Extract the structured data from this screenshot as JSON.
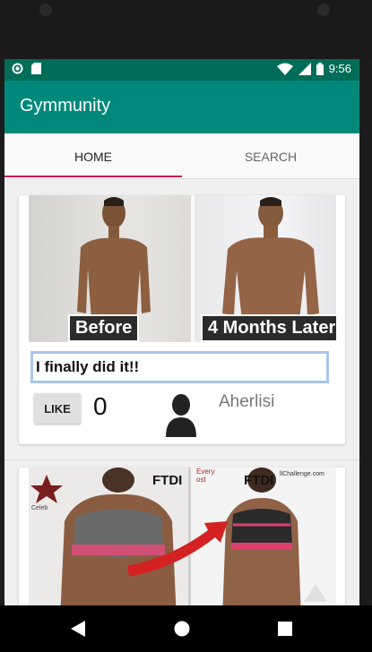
{
  "status_bar": {
    "time": "9:56",
    "icons": [
      "circle-status-icon",
      "sd-card-icon",
      "wifi-icon",
      "signal-icon",
      "battery-icon"
    ]
  },
  "app_bar": {
    "title": "Gymmunity"
  },
  "tabs": [
    {
      "label": "HOME",
      "selected": true
    },
    {
      "label": "SEARCH",
      "selected": false
    }
  ],
  "colors": {
    "status_bar": "#006d58",
    "app_bar": "#00897b",
    "tab_indicator": "#c2185b",
    "caption_border": "#a9c5ee"
  },
  "posts": [
    {
      "photo": {
        "before_label": "Before",
        "after_label": "4 Months Later"
      },
      "caption": "I finally did it!!",
      "like_label": "LIKE",
      "like_count": "0",
      "username": "Aherlisi"
    },
    {
      "photo": {
        "logo_text": "FTDI",
        "side_text_left": "Celeb",
        "side_text_right": "Every\nost",
        "url_text": "llChallenge.com"
      }
    }
  ],
  "nav_bar": {
    "buttons": [
      "back-icon",
      "home-icon",
      "recents-icon"
    ]
  }
}
